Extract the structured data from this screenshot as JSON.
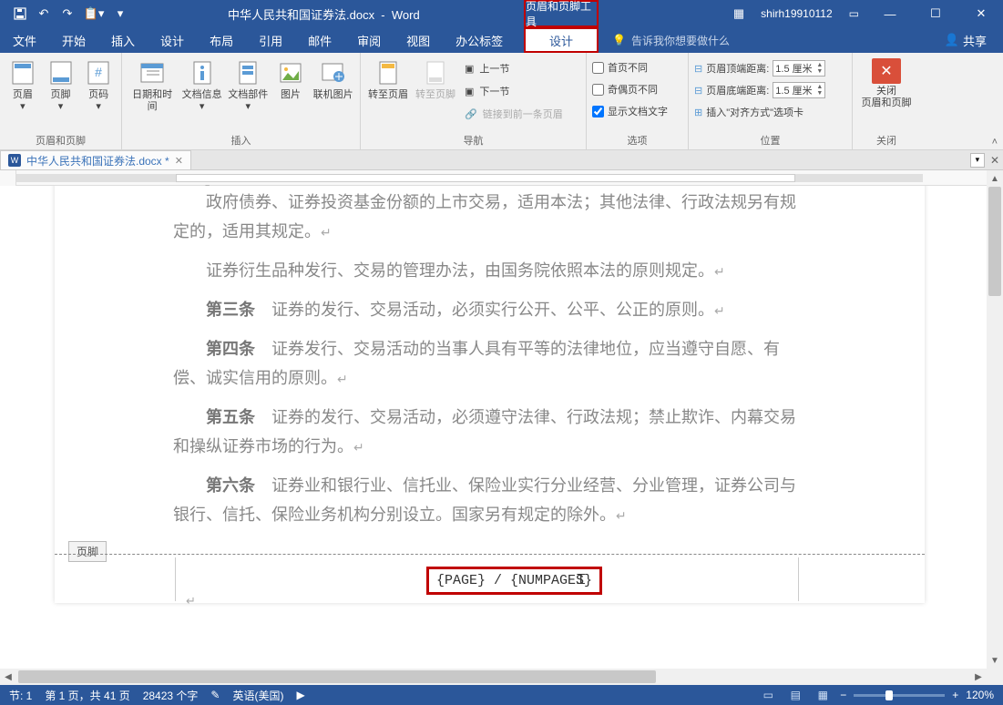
{
  "title": {
    "document": "中华人民共和国证券法.docx",
    "app": "Word",
    "contextual_tab": "页眉和页脚工具",
    "user": "shirh19910112"
  },
  "qat": {
    "touch": "⎘"
  },
  "menu": {
    "file": "文件",
    "home": "开始",
    "insert": "插入",
    "design": "设计",
    "layout": "布局",
    "references": "引用",
    "mailings": "邮件",
    "review": "审阅",
    "view": "视图",
    "office": "办公标签",
    "hf_design": "设计",
    "tell_me": "告诉我你想要做什么",
    "share": "共享"
  },
  "ribbon": {
    "groups": {
      "hf": {
        "label": "页眉和页脚",
        "header": "页眉",
        "footer": "页脚",
        "page_number": "页码"
      },
      "insert": {
        "label": "插入",
        "datetime": "日期和时间",
        "docinfo": "文档信息",
        "quickparts": "文档部件",
        "picture": "图片",
        "onlinepic": "联机图片"
      },
      "nav": {
        "label": "导航",
        "goto_header": "转至页眉",
        "goto_footer": "转至页脚",
        "prev": "上一节",
        "next": "下一节",
        "link": "链接到前一条页眉"
      },
      "options": {
        "label": "选项",
        "diff_first": "首页不同",
        "diff_oddeven": "奇偶页不同",
        "show_text": "显示文档文字"
      },
      "position": {
        "label": "位置",
        "header_top": "页眉顶端距离:",
        "footer_bottom": "页眉底端距离:",
        "header_val": "1.5 厘米",
        "footer_val": "1.5 厘米",
        "insert_align": "插入\"对齐方式\"选项卡"
      },
      "close": {
        "label": "关闭",
        "btn": "关闭\n页眉和页脚"
      }
    }
  },
  "doc_tab": {
    "name": "中华人民共和国证券法.docx *"
  },
  "document": {
    "p1a": "政府债券、证券投资基金份额的上市交易，适用本法；其他法律、行政法规另有规定的，适用其规定。",
    "p2": "证券衍生品种发行、交易的管理办法，由国务院依照本法的原则规定。",
    "a3": "第三条",
    "p3": "证券的发行、交易活动，必须实行公开、公平、公正的原则。",
    "a4": "第四条",
    "p4": "证券发行、交易活动的当事人具有平等的法律地位，应当遵守自愿、有偿、诚实信用的原则。",
    "a5": "第五条",
    "p5": "证券的发行、交易活动，必须遵守法律、行政法规；禁止欺诈、内幕交易和操纵证券市场的行为。",
    "a6": "第六条",
    "p6": "证券业和银行业、信托业、保险业实行分业经营、分业管理，证券公司与银行、信托、保险业务机构分别设立。国家另有规定的除外。"
  },
  "footer": {
    "label": "页脚",
    "field": "{PAGE} / {NUMPAGES}"
  },
  "status": {
    "section": "节: 1",
    "page": "第 1 页，共 41 页",
    "words": "28423 个字",
    "lang": "英语(美国)",
    "zoom": "120%"
  }
}
